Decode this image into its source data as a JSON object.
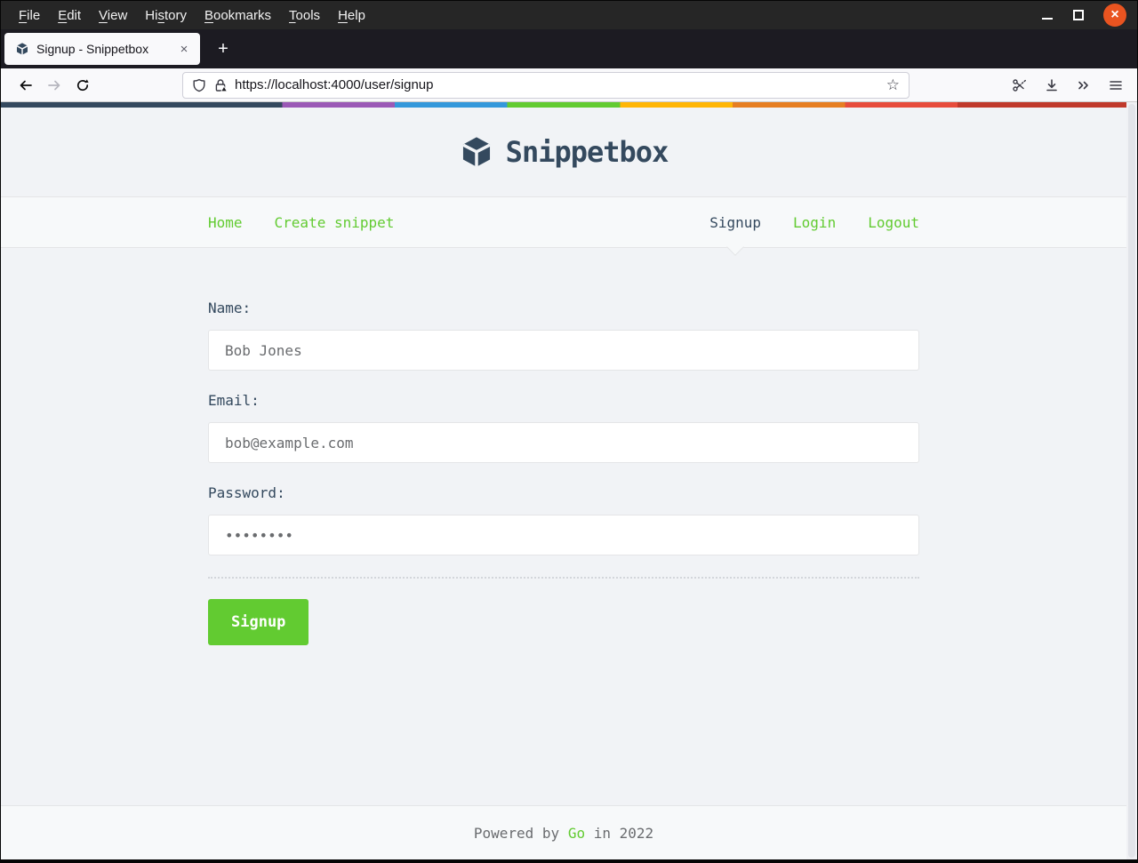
{
  "window": {
    "controls": {
      "minimize": "minimize",
      "maximize": "maximize",
      "close_glyph": "×"
    }
  },
  "menubar": {
    "items": [
      {
        "pre": "",
        "key": "F",
        "post": "ile"
      },
      {
        "pre": "",
        "key": "E",
        "post": "dit"
      },
      {
        "pre": "",
        "key": "V",
        "post": "iew"
      },
      {
        "pre": "Hi",
        "key": "s",
        "post": "tory"
      },
      {
        "pre": "",
        "key": "B",
        "post": "ookmarks"
      },
      {
        "pre": "",
        "key": "T",
        "post": "ools"
      },
      {
        "pre": "",
        "key": "H",
        "post": "elp"
      }
    ]
  },
  "tabbar": {
    "tab": {
      "title": "Signup - Snippetbox",
      "close_glyph": "×"
    },
    "new_tab_glyph": "+"
  },
  "toolbar": {
    "url": "https://localhost:4000/user/signup",
    "bookmark_star_glyph": "☆"
  },
  "page": {
    "stripe": {
      "stops": [
        {
          "color": "#34495e",
          "from": 0,
          "to": 25
        },
        {
          "color": "#9b59b6",
          "from": 25,
          "to": 35
        },
        {
          "color": "#3498db",
          "from": 35,
          "to": 45
        },
        {
          "color": "#62cb31",
          "from": 45,
          "to": 55
        },
        {
          "color": "#ffb606",
          "from": 55,
          "to": 65
        },
        {
          "color": "#e67e22",
          "from": 65,
          "to": 75
        },
        {
          "color": "#e74c3c",
          "from": 75,
          "to": 85
        },
        {
          "color": "#c0392b",
          "from": 85,
          "to": 100
        }
      ]
    },
    "brand": "Snippetbox",
    "nav": {
      "left": [
        {
          "label": "Home"
        },
        {
          "label": "Create snippet"
        }
      ],
      "right": [
        {
          "label": "Signup",
          "active": true
        },
        {
          "label": "Login"
        },
        {
          "label": "Logout"
        }
      ]
    },
    "form": {
      "fields": [
        {
          "label": "Name:",
          "value": "Bob Jones"
        },
        {
          "label": "Email:",
          "value": "bob@example.com"
        },
        {
          "label": "Password:",
          "value": "••••••••"
        }
      ],
      "submit_label": "Signup"
    },
    "footer": {
      "pre": "Powered by ",
      "link": "Go",
      "post": " in 2022"
    },
    "colors": {
      "accent_green": "#62CB31",
      "brand_slate": "#34495E",
      "body_bg": "#F1F3F6",
      "bar_bg": "#F7F9FA",
      "border": "#E4E5E7",
      "muted_text": "#6A6C6F",
      "close_button_orange": "#E95420"
    }
  }
}
